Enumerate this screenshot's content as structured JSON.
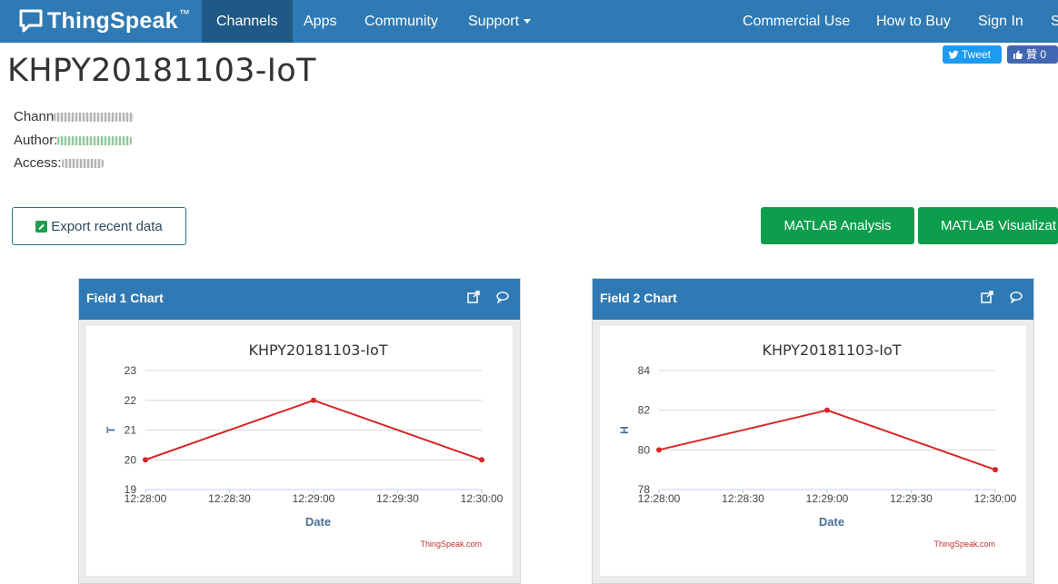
{
  "brand": {
    "name": "ThingSpeak",
    "tm": "™"
  },
  "nav": {
    "items": [
      {
        "label": "Channels",
        "active": true
      },
      {
        "label": "Apps"
      },
      {
        "label": "Community"
      },
      {
        "label": "Support"
      }
    ],
    "right": [
      {
        "label": "Commercial Use"
      },
      {
        "label": "How to Buy"
      },
      {
        "label": "Sign In"
      },
      {
        "label": "S"
      }
    ]
  },
  "page": {
    "title": "KHPY20181103-IoT"
  },
  "social": {
    "tweet": "Tweet",
    "like": "贊 0"
  },
  "meta": {
    "channel_label": "Chann",
    "author_label": "Author:",
    "access_label": "Access:"
  },
  "buttons": {
    "export": "Export recent data",
    "matlab_analysis": "MATLAB Analysis",
    "matlab_vis": "MATLAB Visualizat"
  },
  "colors": {
    "nav": "#2f7ab4",
    "nav_active": "#1f5a87",
    "green": "#0d9e4d",
    "line": "#d62728"
  },
  "panels": [
    {
      "title": "Field 1 Chart"
    },
    {
      "title": "Field 2 Chart"
    }
  ],
  "chart_data": [
    {
      "type": "line",
      "title": "KHPY20181103-IoT",
      "xlabel": "Date",
      "ylabel": "T",
      "credit": "ThingSpeak.com",
      "x_ticks": [
        "12:28:00",
        "12:28:30",
        "12:29:00",
        "12:29:30",
        "12:30:00"
      ],
      "yticks": [
        19,
        20,
        21,
        22,
        23
      ],
      "ylim": [
        19,
        23
      ],
      "x": [
        "12:28:00",
        "12:29:00",
        "12:30:00"
      ],
      "values": [
        20,
        22,
        20
      ],
      "grid": true
    },
    {
      "type": "line",
      "title": "KHPY20181103-IoT",
      "xlabel": "Date",
      "ylabel": "H",
      "credit": "ThingSpeak.com",
      "x_ticks": [
        "12:28:00",
        "12:28:30",
        "12:29:00",
        "12:29:30",
        "12:30:00"
      ],
      "yticks": [
        78,
        80,
        82,
        84
      ],
      "ylim": [
        78,
        84
      ],
      "x": [
        "12:28:00",
        "12:29:00",
        "12:30:00"
      ],
      "values": [
        80,
        82,
        79
      ],
      "grid": true
    }
  ]
}
